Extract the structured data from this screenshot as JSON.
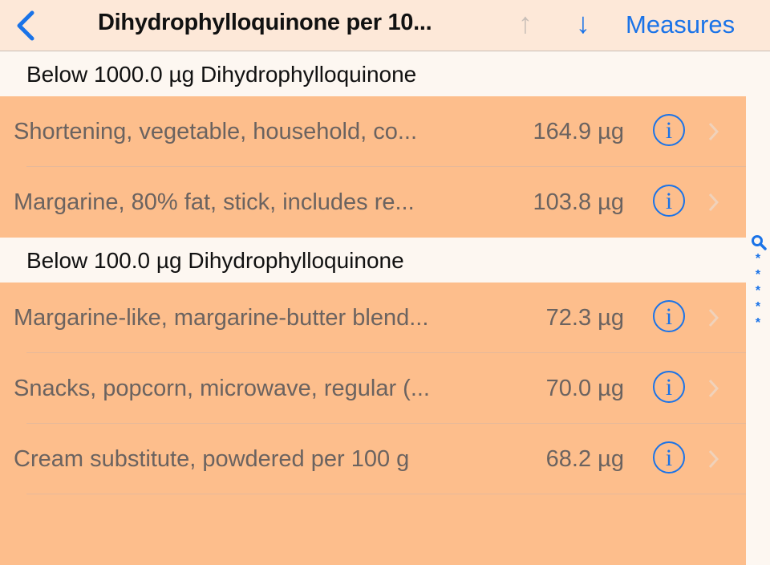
{
  "navbar": {
    "back_icon": "chevron-left-icon",
    "title": "Dihydrophylloquinone per 10...",
    "sort_up_icon": "↑",
    "sort_down_icon": "↓",
    "measures_label": "Measures",
    "accent_color": "#1a73e8"
  },
  "sections": [
    {
      "header": "Below 1000.0 µg Dihydrophylloquinone",
      "rows": [
        {
          "name": "Shortening, vegetable, household, co...",
          "value": "164.9 µg"
        },
        {
          "name": "Margarine, 80% fat, stick, includes re...",
          "value": "103.8 µg"
        }
      ]
    },
    {
      "header": "Below 100.0 µg Dihydrophylloquinone",
      "rows": [
        {
          "name": "Margarine-like, margarine-butter blend...",
          "value": "72.3 µg"
        },
        {
          "name": "Snacks, popcorn, microwave, regular (...",
          "value": "70.0 µg"
        },
        {
          "name": "Cream substitute, powdered per 100 g",
          "value": "68.2 µg"
        }
      ]
    }
  ],
  "row_info_glyph": "i",
  "index": {
    "search_icon": "magnifier-icon",
    "items": [
      "*",
      "*",
      "*",
      "*",
      "*"
    ]
  },
  "colors": {
    "row_bg": "#fdbe8c",
    "section_bg": "#fdf7f1",
    "nav_bg": "#fde8d8"
  }
}
